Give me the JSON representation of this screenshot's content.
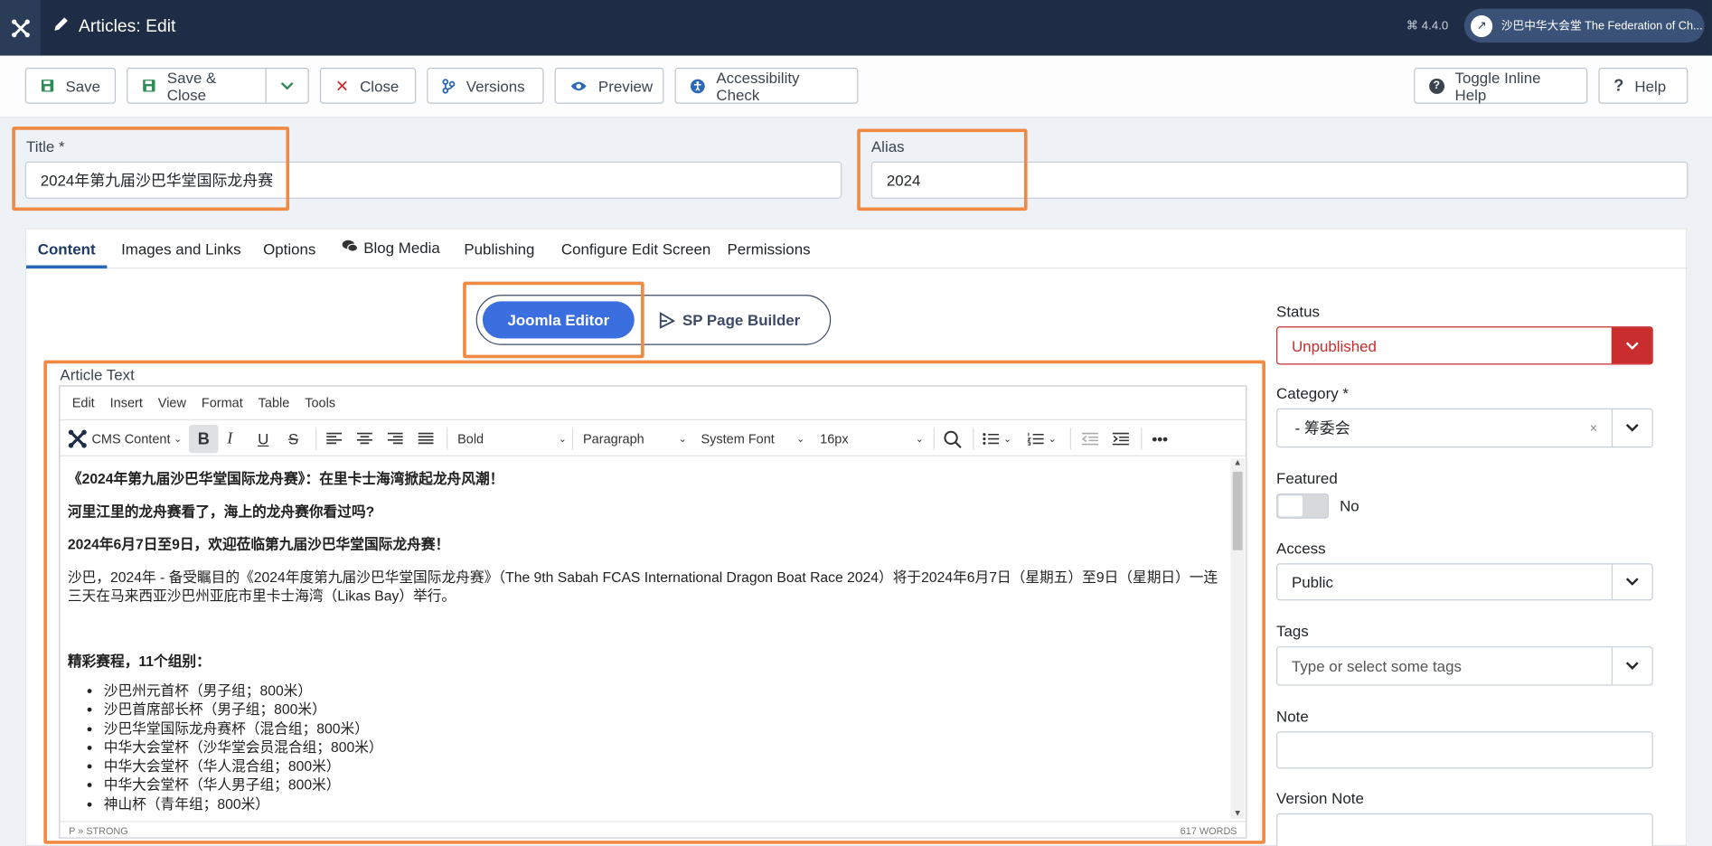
{
  "header": {
    "title": "Articles: Edit",
    "version": "4.4.0",
    "site_name": "沙巴中华大会堂 The Federation of Ch..."
  },
  "toolbar": {
    "save": "Save",
    "save_close": "Save & Close",
    "close": "Close",
    "versions": "Versions",
    "preview": "Preview",
    "accessibility": "Accessibility Check",
    "toggle_help": "Toggle Inline Help",
    "help": "Help"
  },
  "form": {
    "title_label": "Title *",
    "title_value": "2024年第九届沙巴华堂国际龙舟赛",
    "alias_label": "Alias",
    "alias_value": "2024"
  },
  "tabs": [
    "Content",
    "Images and Links",
    "Options",
    "Blog Media",
    "Publishing",
    "Configure Edit Screen",
    "Permissions"
  ],
  "editor_switch": {
    "joomla": "Joomla Editor",
    "sppb": "SP Page Builder"
  },
  "article_text_label": "Article Text",
  "editor": {
    "menu": [
      "Edit",
      "Insert",
      "View",
      "Format",
      "Table",
      "Tools"
    ],
    "cms_content": "CMS Content",
    "font_weight": "Bold",
    "block": "Paragraph",
    "font_family": "System Font",
    "font_size": "16px",
    "path": "P » STRONG",
    "word_count": "617 WORDS"
  },
  "article": {
    "h1": "《2024年第九届沙巴华堂国际龙舟赛》：在里卡士海湾掀起龙舟风潮！",
    "h2": "河里江里的龙舟赛看了，海上的龙舟赛你看过吗?",
    "h3": "2024年6月7日至9日，欢迎莅临第九届沙巴华堂国际龙舟赛！",
    "intro": "沙巴，2024年 - 备受瞩目的《2024年度第九届沙巴华堂国际龙舟赛》（The 9th Sabah FCAS International Dragon Boat Race 2024）将于2024年6月7日（星期五）至9日（星期日）一连三天在马来西亚沙巴州亚庇市里卡士海湾（Likas Bay）举行。",
    "section": "精彩赛程，11个组别：",
    "list": [
      "沙巴州元首杯（男子组；800米）",
      "沙巴首席部长杯（男子组；800米）",
      "沙巴华堂国际龙舟赛杯（混合组；800米）",
      "中华大会堂杯（沙华堂会员混合组；800米）",
      "中华大会堂杯（华人混合组；800米）",
      "中华大会堂杯（华人男子组；800米）",
      "神山杯（青年组；800米）"
    ]
  },
  "sidebar": {
    "status_label": "Status",
    "status_value": "Unpublished",
    "category_label": "Category *",
    "category_value": "- 筹委会",
    "featured_label": "Featured",
    "featured_value": "No",
    "access_label": "Access",
    "access_value": "Public",
    "tags_label": "Tags",
    "tags_placeholder": "Type or select some tags",
    "note_label": "Note",
    "note_value": "",
    "version_note_label": "Version Note"
  },
  "colors": {
    "header": "#1e2d45",
    "accent": "#2a69b8",
    "danger": "#c92d2d",
    "highlight": "#f08a42",
    "joomla_btn": "#3b6fe0"
  }
}
